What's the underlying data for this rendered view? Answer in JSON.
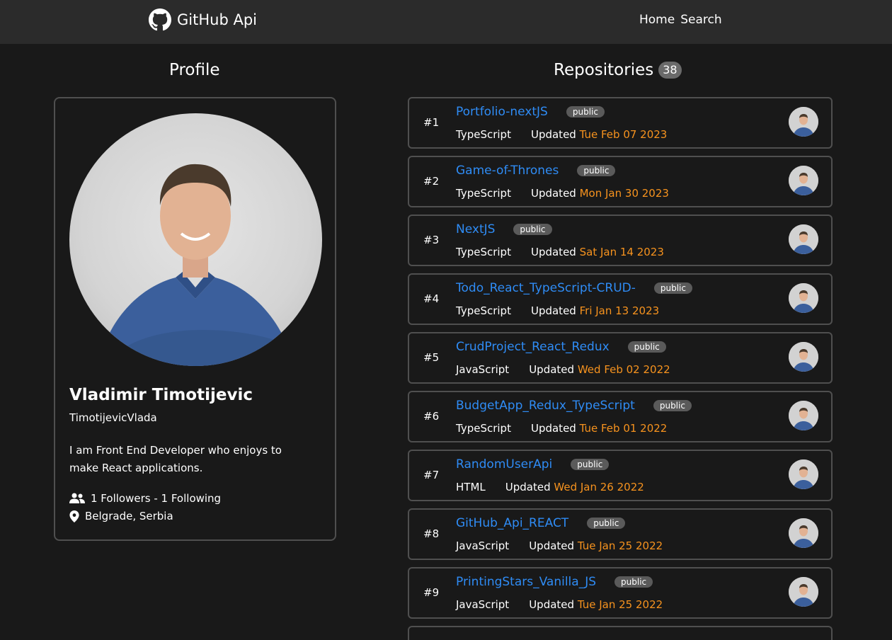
{
  "header": {
    "brand": "GitHub Api",
    "nav": [
      "Home",
      "Search"
    ]
  },
  "profile": {
    "section_title": "Profile",
    "name": "Vladimir Timotijevic",
    "username": "TimotijevicVlada",
    "bio": "I am Front End Developer who enjoys to make React applications.",
    "followers_text": "1 Followers - 1 Following",
    "location": "Belgrade, Serbia"
  },
  "repositories": {
    "section_title": "Repositories",
    "count": "38",
    "items": [
      {
        "num": "#1",
        "name": "Portfolio-nextJS",
        "visibility": "public",
        "language": "TypeScript",
        "updated_label": "Updated",
        "date": "Tue Feb 07 2023"
      },
      {
        "num": "#2",
        "name": "Game-of-Thrones",
        "visibility": "public",
        "language": "TypeScript",
        "updated_label": "Updated",
        "date": "Mon Jan 30 2023"
      },
      {
        "num": "#3",
        "name": "NextJS",
        "visibility": "public",
        "language": "TypeScript",
        "updated_label": "Updated",
        "date": "Sat Jan 14 2023"
      },
      {
        "num": "#4",
        "name": "Todo_React_TypeScript-CRUD-",
        "visibility": "public",
        "language": "TypeScript",
        "updated_label": "Updated",
        "date": "Fri Jan 13 2023"
      },
      {
        "num": "#5",
        "name": "CrudProject_React_Redux",
        "visibility": "public",
        "language": "JavaScript",
        "updated_label": "Updated",
        "date": "Wed Feb 02 2022"
      },
      {
        "num": "#6",
        "name": "BudgetApp_Redux_TypeScript",
        "visibility": "public",
        "language": "TypeScript",
        "updated_label": "Updated",
        "date": "Tue Feb 01 2022"
      },
      {
        "num": "#7",
        "name": "RandomUserApi",
        "visibility": "public",
        "language": "HTML",
        "updated_label": "Updated",
        "date": "Wed Jan 26 2022"
      },
      {
        "num": "#8",
        "name": "GitHub_Api_REACT",
        "visibility": "public",
        "language": "JavaScript",
        "updated_label": "Updated",
        "date": "Tue Jan 25 2022"
      },
      {
        "num": "#9",
        "name": "PrintingStars_Vanilla_JS",
        "visibility": "public",
        "language": "JavaScript",
        "updated_label": "Updated",
        "date": "Tue Jan 25 2022"
      }
    ]
  },
  "icons": {
    "brand": "github-icon",
    "followers": "users-icon",
    "location": "map-pin-icon"
  },
  "colors": {
    "background": "#191919",
    "navbar": "#2b2b2b",
    "link": "#2f8cf5",
    "date": "#f7931e",
    "border": "#4f4f4f"
  }
}
